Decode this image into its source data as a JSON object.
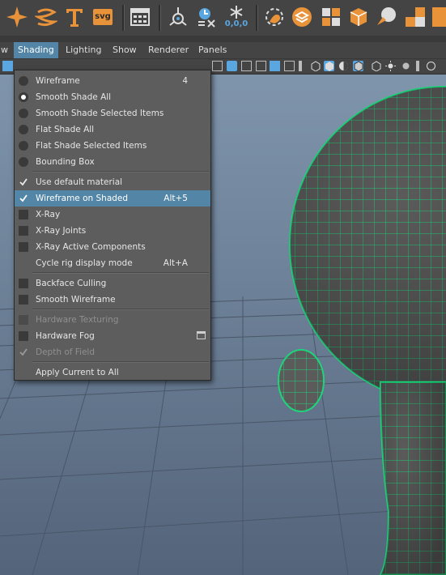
{
  "shelf": {
    "icons": [
      "star-tool-icon",
      "curve-spiral-icon",
      "text-tool-icon",
      "svg-tool-icon",
      "grid-display-icon",
      "pivot-icon",
      "clock-x-icon",
      "snowflake-reset-icon",
      "lasso-icon",
      "layers-icon",
      "quad-split-icon",
      "cube-paint-icon",
      "paint-smear-icon",
      "uv-tiles-icon"
    ],
    "svg_label": "svg",
    "reset_label": "0,0,0"
  },
  "menubar": {
    "items": [
      {
        "label": "w"
      },
      {
        "label": "Shading"
      },
      {
        "label": "Lighting"
      },
      {
        "label": "Show"
      },
      {
        "label": "Renderer"
      },
      {
        "label": "Panels"
      }
    ]
  },
  "menu": {
    "items": [
      {
        "label": "Wireframe",
        "shortcut": "4",
        "mark": "radio-off"
      },
      {
        "label": "Smooth Shade All",
        "shortcut": "",
        "mark": "radio-on"
      },
      {
        "label": "Smooth Shade Selected Items",
        "shortcut": "",
        "mark": "radio-off"
      },
      {
        "label": "Flat Shade All",
        "shortcut": "",
        "mark": "radio-off"
      },
      {
        "label": "Flat Shade Selected Items",
        "shortcut": "",
        "mark": "radio-off"
      },
      {
        "label": "Bounding Box",
        "shortcut": "",
        "mark": "radio-off"
      },
      {
        "label": "Use default material",
        "shortcut": "",
        "mark": "check-on"
      },
      {
        "label": "Wireframe on Shaded",
        "shortcut": "Alt+5",
        "mark": "check-on"
      },
      {
        "label": "X-Ray",
        "shortcut": "",
        "mark": "check-off"
      },
      {
        "label": "X-Ray Joints",
        "shortcut": "",
        "mark": "check-off"
      },
      {
        "label": "X-Ray Active Components",
        "shortcut": "",
        "mark": "check-off"
      },
      {
        "label": "Cycle rig display mode",
        "shortcut": "Alt+A",
        "mark": "none"
      },
      {
        "label": "Backface Culling",
        "shortcut": "",
        "mark": "check-off"
      },
      {
        "label": "Smooth Wireframe",
        "shortcut": "",
        "mark": "check-off"
      },
      {
        "label": "Hardware Texturing",
        "shortcut": "",
        "mark": "check-off"
      },
      {
        "label": "Hardware Fog",
        "shortcut": "",
        "mark": "check-off"
      },
      {
        "label": "Depth of Field",
        "shortcut": "",
        "mark": "check-on"
      },
      {
        "label": "Apply Current to All",
        "shortcut": "",
        "mark": "none"
      }
    ],
    "highlighted": "Wireframe on Shaded",
    "disabled": [
      "Hardware Texturing",
      "Depth of Field"
    ]
  },
  "colors": {
    "accent": "#5285a6",
    "icon_orange": "#e8923a",
    "wire_green": "#1fd37a",
    "mesh_gray": "#5a5a5a"
  }
}
